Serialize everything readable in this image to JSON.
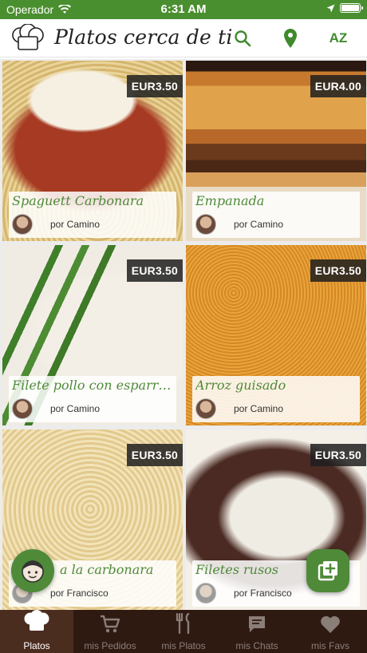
{
  "status_bar": {
    "carrier": "Operador",
    "time": "6:31 AM"
  },
  "header": {
    "title": "Platos cerca de ti",
    "sort_label": "AZ"
  },
  "colors": {
    "brand_green": "#4f8a39",
    "status_green": "#4a8f2f",
    "tab_bar_bg": "#2f1a12"
  },
  "dishes": [
    {
      "name": "Spaguett Carbonara",
      "price": "EUR3.50",
      "author": "por Camino"
    },
    {
      "name": "Empanada",
      "price": "EUR4.00",
      "author": "por Camino"
    },
    {
      "name": "Filete pollo con esparragos y...",
      "price": "EUR3.50",
      "author": "por Camino"
    },
    {
      "name": "Arroz guisado",
      "price": "EUR3.50",
      "author": "por Camino"
    },
    {
      "name": "a la carbonara",
      "price": "EUR3.50",
      "author": "por Francisco"
    },
    {
      "name": "Filetes rusos",
      "price": "EUR3.50",
      "author": "por Francisco"
    }
  ],
  "tabs": [
    {
      "label": "Platos",
      "icon": "chef-hat-icon",
      "active": true
    },
    {
      "label": "mis Pedidos",
      "icon": "cart-icon",
      "active": false
    },
    {
      "label": "mis Platos",
      "icon": "fork-knife-icon",
      "active": false
    },
    {
      "label": "mis Chats",
      "icon": "chat-icon",
      "active": false
    },
    {
      "label": "mis Favs",
      "icon": "heart-icon",
      "active": false
    }
  ]
}
